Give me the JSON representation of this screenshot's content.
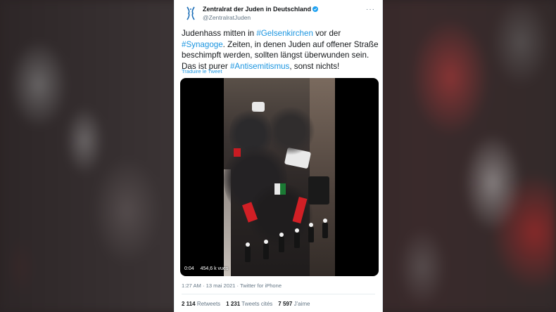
{
  "tweet": {
    "display_name": "Zentralrat der Juden in Deutschland",
    "handle": "@ZentralratJuden",
    "text_segments": [
      {
        "t": "Judenhass mitten in ",
        "tag": false
      },
      {
        "t": "#Gelsenkirchen",
        "tag": true
      },
      {
        "t": " vor der ",
        "tag": false
      },
      {
        "t": "#Synagoge",
        "tag": true
      },
      {
        "t": ". Zeiten, in denen Juden auf offener Straße beschimpft werden, sollten längst überwunden sein. Das ist purer ",
        "tag": false
      },
      {
        "t": "#Antisemitismus",
        "tag": true
      },
      {
        "t": ", sonst nichts!",
        "tag": false
      }
    ],
    "translate_label": "Traduire le Tweet",
    "video": {
      "duration": "0:04",
      "views": "454,6 k vues"
    },
    "timestamp": "1:27 AM · 13 mai 2021 · Twitter for iPhone",
    "stats": {
      "retweets_count": "2 114",
      "retweets_label": "Retweets",
      "quotes_count": "1 231",
      "quotes_label": "Tweets cités",
      "likes_count": "7 597",
      "likes_label": "J'aime"
    }
  },
  "colors": {
    "link": "#1b95e0",
    "verified": "#1da1f2",
    "text": "#14171a",
    "muted": "#657786"
  },
  "icons": {
    "avatar": "zentralrat-logo-icon",
    "verified": "verified-badge-icon",
    "more": "more-options-icon"
  }
}
